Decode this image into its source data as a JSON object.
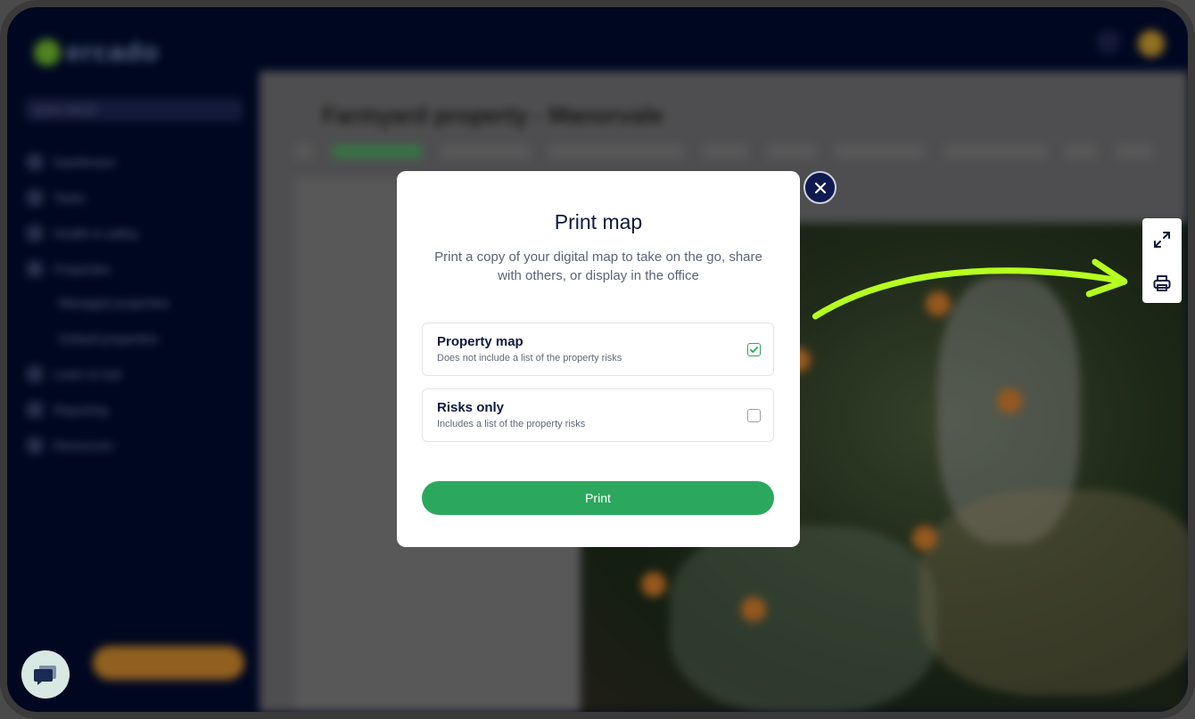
{
  "background": {
    "logo_text": "ercado",
    "search_placeholder": "Quick search",
    "page_title": "Farmyard property - Manorvale",
    "sidebar_items": [
      {
        "label": "Dashboard"
      },
      {
        "label": "Tasks"
      },
      {
        "label": "Health & safety"
      },
      {
        "label": "Properties"
      },
      {
        "label": "Managed properties"
      },
      {
        "label": "Default properties"
      },
      {
        "label": "Learn & hub"
      },
      {
        "label": "Reporting"
      },
      {
        "label": "Resources"
      }
    ]
  },
  "modal": {
    "title": "Print map",
    "description": "Print a copy of your digital map to take on the go, share with others, or display in the office",
    "options": [
      {
        "title": "Property map",
        "subtitle": "Does not include a list of the property risks",
        "checked": true
      },
      {
        "title": "Risks only",
        "subtitle": "Includes a list of the property risks",
        "checked": false
      }
    ],
    "print_label": "Print"
  },
  "map_tools": {
    "fullscreen_icon": "expand-icon",
    "print_icon": "printer-icon"
  },
  "colors": {
    "primary_green": "#2ca85e",
    "annotation_arrow": "#b6ff1f",
    "navy": "#0e1a3d"
  }
}
